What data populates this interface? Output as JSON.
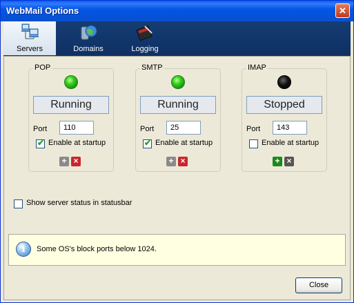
{
  "window": {
    "title": "WebMail Options",
    "close_glyph": "✕"
  },
  "tabs": [
    {
      "label": "Servers",
      "icon": "servers-icon",
      "active": true
    },
    {
      "label": "Domains",
      "icon": "domains-icon",
      "active": false
    },
    {
      "label": "Logging",
      "icon": "logging-icon",
      "active": false
    }
  ],
  "servers": [
    {
      "name": "POP",
      "status": "Running",
      "led": "green",
      "port_label": "Port",
      "port": "110",
      "startup_label": "Enable at startup",
      "startup_checked": true,
      "add_enabled": false,
      "remove_enabled": true
    },
    {
      "name": "SMTP",
      "status": "Running",
      "led": "green",
      "port_label": "Port",
      "port": "25",
      "startup_label": "Enable at startup",
      "startup_checked": true,
      "add_enabled": false,
      "remove_enabled": true
    },
    {
      "name": "IMAP",
      "status": "Stopped",
      "led": "black",
      "port_label": "Port",
      "port": "143",
      "startup_label": "Enable at startup",
      "startup_checked": false,
      "add_enabled": true,
      "remove_enabled": false
    }
  ],
  "show_status_label": "Show server status in statusbar",
  "show_status_checked": false,
  "info": {
    "text": "Some OS's block ports below 1024.",
    "icon": "info-icon"
  },
  "close_button": "Close",
  "colors": {
    "titlebar": "#0a5fef",
    "toolbar": "#153d74",
    "info_bg": "#ffffe1",
    "led_on": "#36d11d",
    "led_off": "#000000"
  }
}
